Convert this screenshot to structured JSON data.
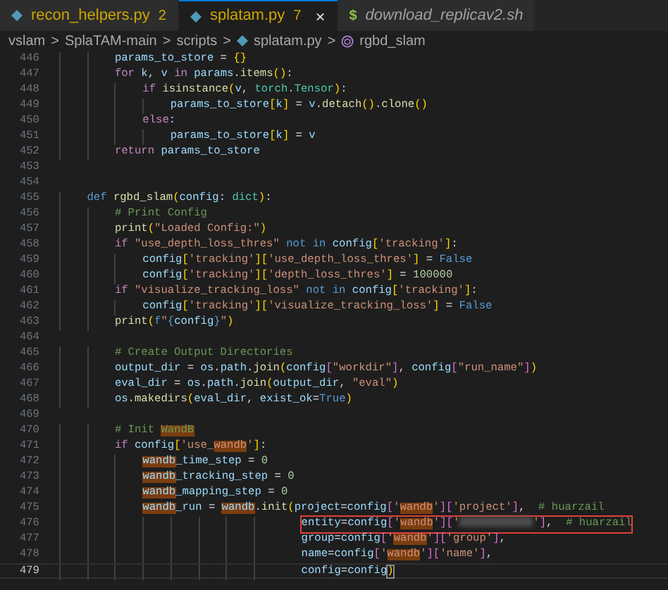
{
  "tabs": [
    {
      "label": "recon_helpers.py",
      "badge": "2",
      "kind": "py",
      "selected": false,
      "preview": false,
      "warning": true
    },
    {
      "label": "splatam.py",
      "badge": "7",
      "kind": "py",
      "selected": true,
      "preview": false,
      "warning": true,
      "close": "×"
    },
    {
      "label": "download_replicav2.sh",
      "kind": "sh",
      "icon_text": "$",
      "selected": false,
      "preview": true,
      "warning": false
    }
  ],
  "breadcrumb": [
    {
      "label": "vslam",
      "kind": "folder"
    },
    {
      "label": "SplaTAM-main",
      "kind": "folder"
    },
    {
      "label": "scripts",
      "kind": "folder"
    },
    {
      "label": "splatam.py",
      "kind": "py"
    },
    {
      "label": "rgbd_slam",
      "kind": "function"
    }
  ],
  "separator": ">",
  "lines": [
    {
      "number": "446",
      "tokens": [
        {
          "text": "        params_to_store",
          "kind": "var"
        },
        {
          "text": " = ",
          "kind": "plain"
        },
        {
          "text": "{}",
          "kind": "bracket1"
        }
      ]
    },
    {
      "number": "447",
      "tokens": [
        {
          "text": "        for ",
          "kind": "keyword"
        },
        {
          "text": "k",
          "kind": "var"
        },
        {
          "text": ", ",
          "kind": "plain"
        },
        {
          "text": "v ",
          "kind": "var"
        },
        {
          "text": "in ",
          "kind": "keyword"
        },
        {
          "text": "params",
          "kind": "var"
        },
        {
          "text": ".",
          "kind": "plain"
        },
        {
          "text": "items",
          "kind": "func"
        },
        {
          "text": "()",
          "kind": "bracket1"
        },
        {
          "text": ":",
          "kind": "plain"
        }
      ]
    },
    {
      "number": "448",
      "tokens": [
        {
          "text": "            if ",
          "kind": "keyword"
        },
        {
          "text": "isinstance",
          "kind": "func"
        },
        {
          "text": "(",
          "kind": "bracket1"
        },
        {
          "text": "v",
          "kind": "var"
        },
        {
          "text": ", ",
          "kind": "plain"
        },
        {
          "text": "torch",
          "kind": "class"
        },
        {
          "text": ".",
          "kind": "plain"
        },
        {
          "text": "Tensor",
          "kind": "class"
        },
        {
          "text": ")",
          "kind": "bracket1"
        },
        {
          "text": ":",
          "kind": "plain"
        }
      ]
    },
    {
      "number": "449",
      "tokens": [
        {
          "text": "                params_to_store",
          "kind": "var"
        },
        {
          "text": "[",
          "kind": "bracket1"
        },
        {
          "text": "k",
          "kind": "var"
        },
        {
          "text": "]",
          "kind": "bracket1"
        },
        {
          "text": " = ",
          "kind": "plain"
        },
        {
          "text": "v",
          "kind": "var"
        },
        {
          "text": ".",
          "kind": "plain"
        },
        {
          "text": "detach",
          "kind": "func"
        },
        {
          "text": "()",
          "kind": "bracket1"
        },
        {
          "text": ".",
          "kind": "plain"
        },
        {
          "text": "clone",
          "kind": "func"
        },
        {
          "text": "()",
          "kind": "bracket1"
        }
      ]
    },
    {
      "number": "450",
      "tokens": [
        {
          "text": "            else",
          "kind": "keyword"
        },
        {
          "text": ":",
          "kind": "plain"
        }
      ]
    },
    {
      "number": "451",
      "tokens": [
        {
          "text": "                params_to_store",
          "kind": "var"
        },
        {
          "text": "[",
          "kind": "bracket1"
        },
        {
          "text": "k",
          "kind": "var"
        },
        {
          "text": "]",
          "kind": "bracket1"
        },
        {
          "text": " = ",
          "kind": "plain"
        },
        {
          "text": "v",
          "kind": "var"
        }
      ]
    },
    {
      "number": "452",
      "tokens": [
        {
          "text": "        return ",
          "kind": "keyword"
        },
        {
          "text": "params_to_store",
          "kind": "var"
        }
      ]
    },
    {
      "number": "453"
    },
    {
      "number": "454"
    },
    {
      "number": "455",
      "tokens": [
        {
          "text": "    def ",
          "kind": "const"
        },
        {
          "text": "rgbd_slam",
          "kind": "func"
        },
        {
          "text": "(",
          "kind": "bracket1"
        },
        {
          "text": "config",
          "kind": "var"
        },
        {
          "text": ": ",
          "kind": "plain"
        },
        {
          "text": "dict",
          "kind": "class"
        },
        {
          "text": ")",
          "kind": "bracket1"
        },
        {
          "text": ":",
          "kind": "plain"
        }
      ]
    },
    {
      "number": "456",
      "tokens": [
        {
          "text": "        # Print Config",
          "kind": "comment"
        }
      ]
    },
    {
      "number": "457",
      "tokens": [
        {
          "text": "        print",
          "kind": "func"
        },
        {
          "text": "(",
          "kind": "bracket1"
        },
        {
          "text": "\"Loaded Config:\"",
          "kind": "string"
        },
        {
          "text": ")",
          "kind": "bracket1"
        }
      ]
    },
    {
      "number": "458",
      "tokens": [
        {
          "text": "        if ",
          "kind": "keyword"
        },
        {
          "text": "\"use_depth_loss_thres\" ",
          "kind": "string"
        },
        {
          "text": "not in ",
          "kind": "const"
        },
        {
          "text": "config",
          "kind": "var"
        },
        {
          "text": "[",
          "kind": "bracket1"
        },
        {
          "text": "'tracking'",
          "kind": "string"
        },
        {
          "text": "]",
          "kind": "bracket1"
        },
        {
          "text": ":",
          "kind": "plain"
        }
      ]
    },
    {
      "number": "459",
      "tokens": [
        {
          "text": "            config",
          "kind": "var"
        },
        {
          "text": "[",
          "kind": "bracket1"
        },
        {
          "text": "'tracking'",
          "kind": "string"
        },
        {
          "text": "][",
          "kind": "bracket1"
        },
        {
          "text": "'use_depth_loss_thres'",
          "kind": "string"
        },
        {
          "text": "]",
          "kind": "bracket1"
        },
        {
          "text": " = ",
          "kind": "plain"
        },
        {
          "text": "False",
          "kind": "const"
        }
      ]
    },
    {
      "number": "460",
      "tokens": [
        {
          "text": "            config",
          "kind": "var"
        },
        {
          "text": "[",
          "kind": "bracket1"
        },
        {
          "text": "'tracking'",
          "kind": "string"
        },
        {
          "text": "][",
          "kind": "bracket1"
        },
        {
          "text": "'depth_loss_thres'",
          "kind": "string"
        },
        {
          "text": "]",
          "kind": "bracket1"
        },
        {
          "text": " = ",
          "kind": "plain"
        },
        {
          "text": "100000",
          "kind": "number"
        }
      ]
    },
    {
      "number": "461",
      "tokens": [
        {
          "text": "        if ",
          "kind": "keyword"
        },
        {
          "text": "\"visualize_tracking_loss\" ",
          "kind": "string"
        },
        {
          "text": "not in ",
          "kind": "const"
        },
        {
          "text": "config",
          "kind": "var"
        },
        {
          "text": "[",
          "kind": "bracket1"
        },
        {
          "text": "'tracking'",
          "kind": "string"
        },
        {
          "text": "]",
          "kind": "bracket1"
        },
        {
          "text": ":",
          "kind": "plain"
        }
      ]
    },
    {
      "number": "462",
      "tokens": [
        {
          "text": "            config",
          "kind": "var"
        },
        {
          "text": "[",
          "kind": "bracket1"
        },
        {
          "text": "'tracking'",
          "kind": "string"
        },
        {
          "text": "][",
          "kind": "bracket1"
        },
        {
          "text": "'visualize_tracking_loss'",
          "kind": "string"
        },
        {
          "text": "]",
          "kind": "bracket1"
        },
        {
          "text": " = ",
          "kind": "plain"
        },
        {
          "text": "False",
          "kind": "const"
        }
      ]
    },
    {
      "number": "463",
      "tokens": [
        {
          "text": "        print",
          "kind": "func"
        },
        {
          "text": "(",
          "kind": "bracket1"
        },
        {
          "text": "f",
          "kind": "const"
        },
        {
          "text": "\"",
          "kind": "string"
        },
        {
          "text": "{",
          "kind": "const"
        },
        {
          "text": "config",
          "kind": "var"
        },
        {
          "text": "}",
          "kind": "const"
        },
        {
          "text": "\"",
          "kind": "string"
        },
        {
          "text": ")",
          "kind": "bracket1"
        }
      ]
    },
    {
      "number": "464"
    },
    {
      "number": "465",
      "tokens": [
        {
          "text": "        # Create Output Directories",
          "kind": "comment"
        }
      ]
    },
    {
      "number": "466",
      "tokens": [
        {
          "text": "        output_dir",
          "kind": "var"
        },
        {
          "text": " = ",
          "kind": "plain"
        },
        {
          "text": "os",
          "kind": "var"
        },
        {
          "text": ".",
          "kind": "plain"
        },
        {
          "text": "path",
          "kind": "var"
        },
        {
          "text": ".",
          "kind": "plain"
        },
        {
          "text": "join",
          "kind": "func"
        },
        {
          "text": "(",
          "kind": "bracket1"
        },
        {
          "text": "config",
          "kind": "var"
        },
        {
          "text": "[",
          "kind": "bracket2"
        },
        {
          "text": "\"workdir\"",
          "kind": "string"
        },
        {
          "text": "]",
          "kind": "bracket2"
        },
        {
          "text": ", ",
          "kind": "plain"
        },
        {
          "text": "config",
          "kind": "var"
        },
        {
          "text": "[",
          "kind": "bracket2"
        },
        {
          "text": "\"run_name\"",
          "kind": "string"
        },
        {
          "text": "]",
          "kind": "bracket2"
        },
        {
          "text": ")",
          "kind": "bracket1"
        }
      ]
    },
    {
      "number": "467",
      "tokens": [
        {
          "text": "        eval_dir",
          "kind": "var"
        },
        {
          "text": " = ",
          "kind": "plain"
        },
        {
          "text": "os",
          "kind": "var"
        },
        {
          "text": ".",
          "kind": "plain"
        },
        {
          "text": "path",
          "kind": "var"
        },
        {
          "text": ".",
          "kind": "plain"
        },
        {
          "text": "join",
          "kind": "func"
        },
        {
          "text": "(",
          "kind": "bracket1"
        },
        {
          "text": "output_dir",
          "kind": "var"
        },
        {
          "text": ", ",
          "kind": "plain"
        },
        {
          "text": "\"eval\"",
          "kind": "string"
        },
        {
          "text": ")",
          "kind": "bracket1"
        }
      ]
    },
    {
      "number": "468",
      "tokens": [
        {
          "text": "        os",
          "kind": "var"
        },
        {
          "text": ".",
          "kind": "plain"
        },
        {
          "text": "makedirs",
          "kind": "func"
        },
        {
          "text": "(",
          "kind": "bracket1"
        },
        {
          "text": "eval_dir",
          "kind": "var"
        },
        {
          "text": ", ",
          "kind": "plain"
        },
        {
          "text": "exist_ok",
          "kind": "var"
        },
        {
          "text": "=",
          "kind": "plain"
        },
        {
          "text": "True",
          "kind": "const"
        },
        {
          "text": ")",
          "kind": "bracket1"
        }
      ]
    },
    {
      "number": "469"
    },
    {
      "number": "470",
      "tokens": [
        {
          "text": "        # Init ",
          "kind": "comment",
          "find": false
        },
        {
          "text": "WandB",
          "kind": "comment",
          "find": true
        }
      ]
    },
    {
      "number": "471",
      "tokens": [
        {
          "text": "        if ",
          "kind": "keyword"
        },
        {
          "text": "config",
          "kind": "var"
        },
        {
          "text": "[",
          "kind": "bracket1"
        },
        {
          "text": "'use_",
          "kind": "string",
          "find": false
        },
        {
          "text": "wandb",
          "kind": "string",
          "find": true
        },
        {
          "text": "'",
          "kind": "string"
        },
        {
          "text": "]",
          "kind": "bracket1"
        },
        {
          "text": ":",
          "kind": "plain"
        }
      ]
    },
    {
      "number": "472",
      "tokens": [
        {
          "text": "            wandb",
          "kind": "var",
          "find": true
        },
        {
          "text": "_time_step",
          "kind": "var",
          "find": false
        },
        {
          "text": " = ",
          "kind": "plain"
        },
        {
          "text": "0",
          "kind": "number"
        }
      ]
    },
    {
      "number": "473",
      "tokens": [
        {
          "text": "            wandb",
          "kind": "var",
          "find": true
        },
        {
          "text": "_tracking_step",
          "kind": "var",
          "find": false
        },
        {
          "text": " = ",
          "kind": "plain"
        },
        {
          "text": "0",
          "kind": "number"
        }
      ]
    },
    {
      "number": "474",
      "tokens": [
        {
          "text": "            wandb",
          "kind": "var",
          "find": true
        },
        {
          "text": "_mapping_step",
          "kind": "var",
          "find": false
        },
        {
          "text": " = ",
          "kind": "plain"
        },
        {
          "text": "0",
          "kind": "number"
        }
      ]
    },
    {
      "number": "475",
      "tokens": [
        {
          "text": "            wandb",
          "kind": "var",
          "find": true
        },
        {
          "text": "_run",
          "kind": "var",
          "find": false
        },
        {
          "text": " = ",
          "kind": "plain"
        },
        {
          "text": "wandb",
          "kind": "var",
          "find": true
        },
        {
          "text": ".",
          "kind": "plain"
        },
        {
          "text": "init",
          "kind": "func"
        },
        {
          "text": "(",
          "kind": "bracket1"
        },
        {
          "text": "project",
          "kind": "var"
        },
        {
          "text": "=",
          "kind": "plain"
        },
        {
          "text": "config",
          "kind": "var"
        },
        {
          "text": "[",
          "kind": "bracket2"
        },
        {
          "text": "'",
          "kind": "string"
        },
        {
          "text": "wandb",
          "kind": "string",
          "find": true
        },
        {
          "text": "'",
          "kind": "string"
        },
        {
          "text": "][",
          "kind": "bracket2"
        },
        {
          "text": "'project'",
          "kind": "string"
        },
        {
          "text": "]",
          "kind": "bracket2"
        },
        {
          "text": ",  ",
          "kind": "plain"
        },
        {
          "text": "# huarzail",
          "kind": "comment"
        }
      ]
    },
    {
      "number": "476",
      "boxed": true,
      "tokens": [
        {
          "text": "                                   entity",
          "kind": "var"
        },
        {
          "text": "=",
          "kind": "plain"
        },
        {
          "text": "config",
          "kind": "var"
        },
        {
          "text": "[",
          "kind": "bracket2"
        },
        {
          "text": "'",
          "kind": "string"
        },
        {
          "text": "wandb",
          "kind": "string",
          "find": true
        },
        {
          "text": "'",
          "kind": "string"
        },
        {
          "text": "][",
          "kind": "bracket2"
        },
        {
          "text": "'",
          "kind": "string"
        },
        {
          "kind": "blur"
        },
        {
          "text": "'",
          "kind": "string"
        },
        {
          "text": "]",
          "kind": "bracket2"
        },
        {
          "text": ",  ",
          "kind": "plain"
        },
        {
          "text": "# huarzail",
          "kind": "comment"
        }
      ]
    },
    {
      "number": "477",
      "tokens": [
        {
          "text": "                                   group",
          "kind": "var"
        },
        {
          "text": "=",
          "kind": "plain"
        },
        {
          "text": "config",
          "kind": "var"
        },
        {
          "text": "[",
          "kind": "bracket2"
        },
        {
          "text": "'",
          "kind": "string"
        },
        {
          "text": "wandb",
          "kind": "string",
          "find": true
        },
        {
          "text": "'",
          "kind": "string"
        },
        {
          "text": "][",
          "kind": "bracket2"
        },
        {
          "text": "'group'",
          "kind": "string"
        },
        {
          "text": "]",
          "kind": "bracket2"
        },
        {
          "text": ",",
          "kind": "plain"
        }
      ]
    },
    {
      "number": "478",
      "tokens": [
        {
          "text": "                                   name",
          "kind": "var"
        },
        {
          "text": "=",
          "kind": "plain"
        },
        {
          "text": "config",
          "kind": "var"
        },
        {
          "text": "[",
          "kind": "bracket2"
        },
        {
          "text": "'",
          "kind": "string"
        },
        {
          "text": "wandb",
          "kind": "string",
          "find": true
        },
        {
          "text": "'",
          "kind": "string"
        },
        {
          "text": "][",
          "kind": "bracket2"
        },
        {
          "text": "'name'",
          "kind": "string"
        },
        {
          "text": "]",
          "kind": "bracket2"
        },
        {
          "text": ",",
          "kind": "plain"
        }
      ]
    },
    {
      "number": "479",
      "current": true,
      "tokens": [
        {
          "text": "                                   config",
          "kind": "var"
        },
        {
          "text": "=",
          "kind": "plain"
        },
        {
          "text": "config",
          "kind": "var"
        },
        {
          "text": ")",
          "kind": "bracket1",
          "match": true
        }
      ]
    }
  ]
}
